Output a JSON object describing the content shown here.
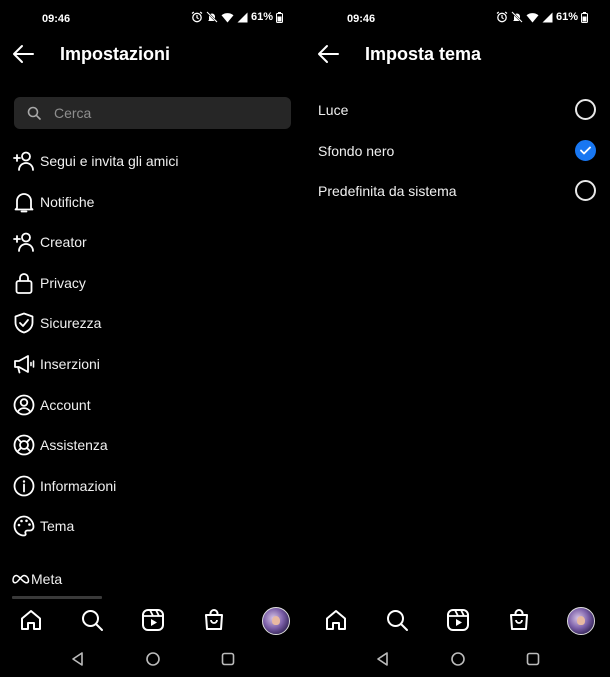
{
  "left": {
    "status": {
      "time": "09:46",
      "battery": "61%"
    },
    "header": {
      "title": "Impostazioni"
    },
    "search": {
      "placeholder": "Cerca"
    },
    "menu": [
      {
        "label": "Segui e invita gli amici",
        "icon": "add-person-icon"
      },
      {
        "label": "Notifiche",
        "icon": "bell-icon"
      },
      {
        "label": "Creator",
        "icon": "add-person-icon"
      },
      {
        "label": "Privacy",
        "icon": "lock-icon"
      },
      {
        "label": "Sicurezza",
        "icon": "shield-icon"
      },
      {
        "label": "Inserzioni",
        "icon": "megaphone-icon"
      },
      {
        "label": "Account",
        "icon": "account-circle-icon"
      },
      {
        "label": "Assistenza",
        "icon": "lifebuoy-icon"
      },
      {
        "label": "Informazioni",
        "icon": "info-icon"
      },
      {
        "label": "Tema",
        "icon": "palette-icon"
      }
    ],
    "meta": {
      "label": "Meta"
    }
  },
  "right": {
    "status": {
      "time": "09:46",
      "battery": "61%"
    },
    "header": {
      "title": "Imposta tema"
    },
    "options": [
      {
        "label": "Luce",
        "selected": false
      },
      {
        "label": "Sfondo nero",
        "selected": true
      },
      {
        "label": "Predefinita da sistema",
        "selected": false
      }
    ]
  },
  "tabbar": [
    "home-icon",
    "search-icon",
    "reels-icon",
    "shop-icon",
    "avatar"
  ],
  "navbar": [
    "back-triangle-icon",
    "home-circle-icon",
    "recents-square-icon"
  ],
  "colors": {
    "background": "#000000",
    "accent": "#1877f2",
    "search_bg": "#262626"
  }
}
